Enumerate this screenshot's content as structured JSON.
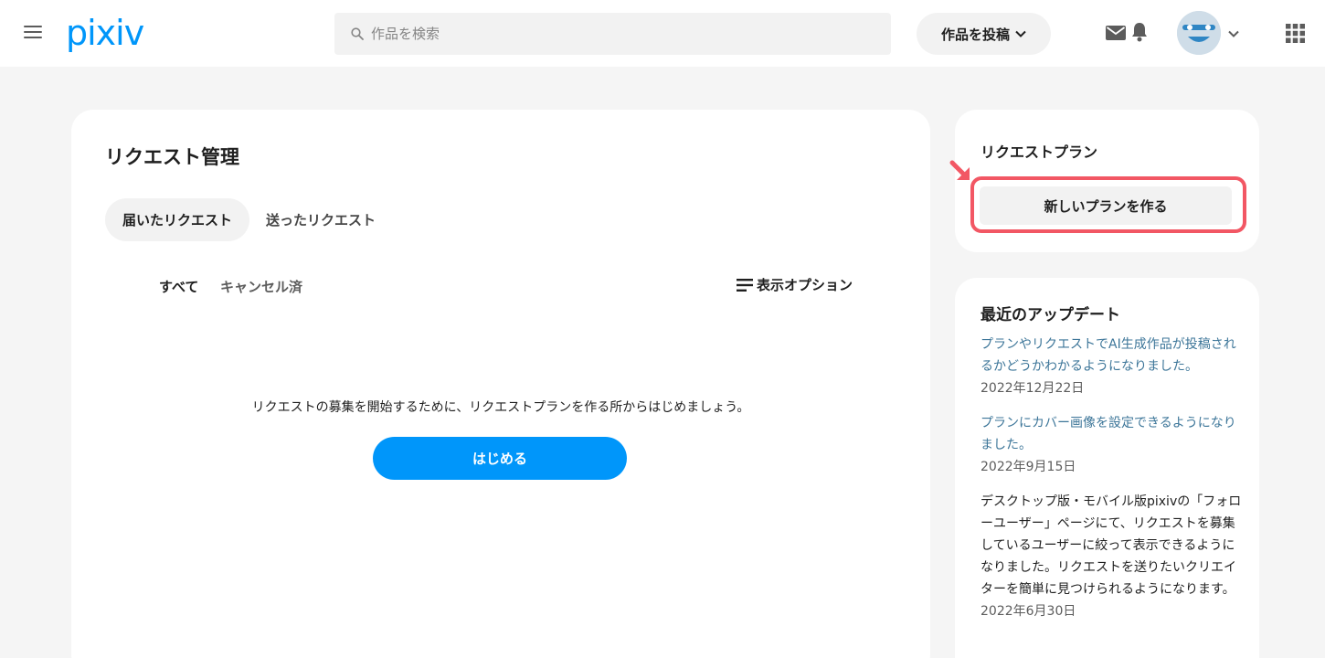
{
  "header": {
    "logo": "pixiv",
    "search_placeholder": "作品を検索",
    "post_label": "作品を投稿"
  },
  "main": {
    "title": "リクエスト管理",
    "tabs": [
      {
        "label": "届いたリクエスト",
        "active": true
      },
      {
        "label": "送ったリクエスト",
        "active": false
      }
    ],
    "filters": [
      {
        "label": "すべて",
        "active": true
      },
      {
        "label": "キャンセル済",
        "active": false
      }
    ],
    "display_options_label": "表示オプション",
    "empty_message": "リクエストの募集を開始するために、リクエストプランを作る所からはじめましょう。",
    "start_label": "はじめる"
  },
  "plan": {
    "title": "リクエストプラン",
    "new_plan_label": "新しいプランを作る"
  },
  "updates": {
    "title": "最近のアップデート",
    "items": [
      {
        "text": "プランやリクエストでAI生成作品が投稿されるかどうかわかるようになりました。",
        "date": "2022年12月22日",
        "link": true
      },
      {
        "text": "プランにカバー画像を設定できるようになりました。",
        "date": "2022年9月15日",
        "link": true
      },
      {
        "text": "デスクトップ版・モバイル版pixivの「フォローユーザー」ページにて、リクエストを募集しているユーザーに絞って表示できるようになりました。リクエストを送りたいクリエイターを簡単に見つけられるようになります。",
        "date": "2022年6月30日",
        "link": false
      }
    ]
  },
  "colors": {
    "brand": "#0096fa",
    "highlight": "#f25764",
    "link": "#3d7699"
  }
}
